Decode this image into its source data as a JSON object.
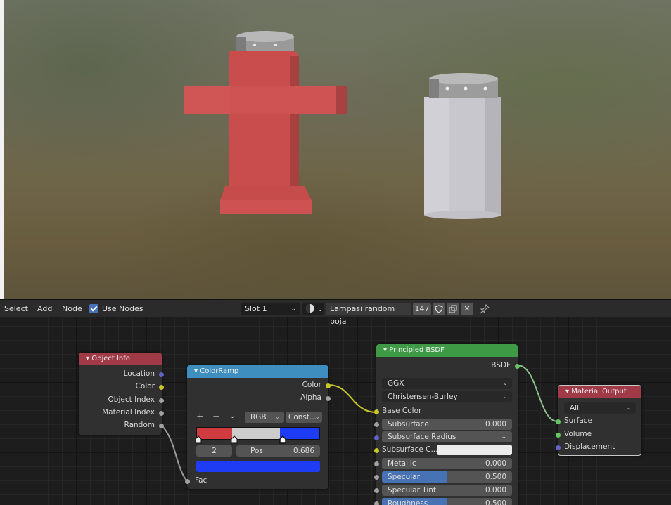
{
  "header": {
    "menu": [
      "Select",
      "Add",
      "Node"
    ],
    "use_nodes_label": "Use Nodes",
    "use_nodes_checked": true,
    "slot": "Slot 1",
    "material_name": "Lampasi random boja",
    "user_count": "147"
  },
  "nodes": {
    "object_info": {
      "title": "Object Info",
      "outputs": [
        "Location",
        "Color",
        "Object Index",
        "Material Index",
        "Random"
      ]
    },
    "color_ramp": {
      "title": "ColorRamp",
      "outputs": [
        "Color",
        "Alpha"
      ],
      "color_mode": "RGB",
      "interpolation": "Const...",
      "plus": "+",
      "minus": "−",
      "stop_index": "2",
      "pos_label": "Pos",
      "pos_value": "0.686",
      "input": "Fac"
    },
    "principled": {
      "title": "Principled BSDF",
      "output": "BSDF",
      "distribution": "GGX",
      "subsurface_method": "Christensen-Burley",
      "base_color_label": "Base Color",
      "fields": [
        {
          "label": "Subsurface",
          "value": "0.000"
        },
        {
          "label": "Subsurface Radius",
          "value": ""
        },
        {
          "label": "Subsurface C...",
          "value": ""
        },
        {
          "label": "Metallic",
          "value": "0.000"
        },
        {
          "label": "Specular",
          "value": "0.500"
        },
        {
          "label": "Specular Tint",
          "value": "0.000"
        },
        {
          "label": "Roughness",
          "value": "0.500"
        }
      ]
    },
    "material_output": {
      "title": "Material Output",
      "target": "All",
      "inputs": [
        "Surface",
        "Volume",
        "Displacement"
      ]
    }
  },
  "colors": {
    "object_info_header": "#a03a47",
    "color_ramp_header": "#3e8fc0",
    "principled_header": "#3e9a45",
    "output_header": "#a03a47",
    "ramp_red": "#cf3b3f",
    "ramp_grey": "#cccccc",
    "ramp_blue": "#1f3cf5"
  }
}
